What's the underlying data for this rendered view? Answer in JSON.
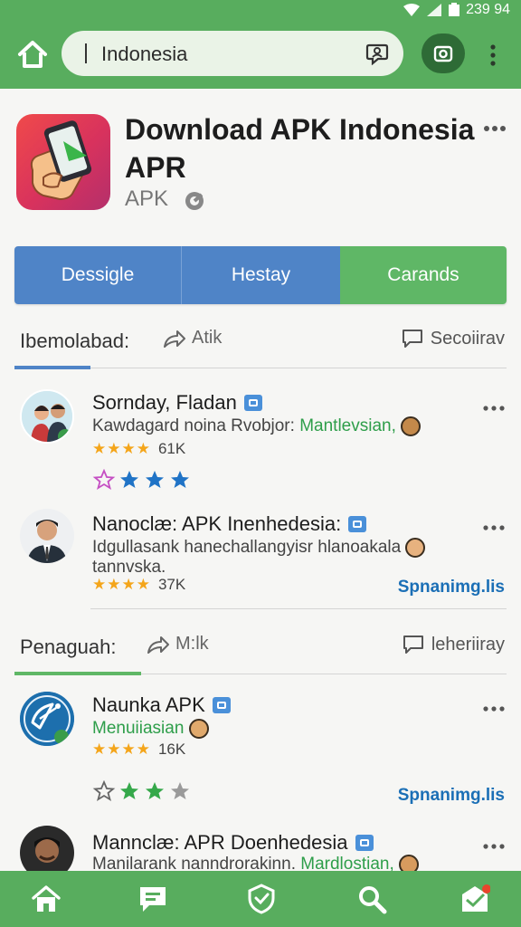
{
  "status_bar": {
    "time": "239 94"
  },
  "browser": {
    "url_text": "Indonesia"
  },
  "app": {
    "title": "Download APK Indonesia APR",
    "subtitle": "APK"
  },
  "tabs": [
    "Dessigle",
    "Hestay",
    "Carands"
  ],
  "sections": [
    {
      "title": "Ibemolabad:",
      "share_label": "Atik",
      "comment_label": "Secoiirav",
      "items": [
        {
          "name": "Sornday, Fladan",
          "desc_plain": "Kawdagard noina Rvobjor: ",
          "desc_highlight": "Mantlevsian,",
          "stars": "★★★★",
          "count": "61K"
        },
        {
          "name": "Nanoclæ: APK Inenhedesia:",
          "desc_plain": "Idgullasank hanechallangyisr hlanoakala",
          "desc_line2": "tannvska.",
          "stars": "★★★★",
          "count": "37K",
          "link": "Spnanimg.lis"
        }
      ]
    },
    {
      "title": "Penaguah:",
      "share_label": "M:lk",
      "comment_label": "leheriiray",
      "items": [
        {
          "name": "Naunka APK",
          "desc_highlight": "Menuiiasian",
          "stars": "★★★★",
          "count": "16K",
          "link": "Spnanimg.lis"
        },
        {
          "name": "Mannclæ: APR Doenhedesia",
          "desc_plain": "Manilarank nanndrorakinn. ",
          "desc_highlight": "Mardlostian,"
        }
      ]
    }
  ],
  "colors": {
    "brand_green": "#58ad5e",
    "tab_blue": "#4f84c7",
    "tab_green": "#5fb766",
    "link_blue": "#1b6fb6",
    "highlight_green": "#2e9e4a",
    "star_gold": "#f4a51a"
  },
  "icons": {
    "bottom_nav": [
      "home-icon",
      "chat-icon",
      "shield-icon",
      "search-icon",
      "inbox-icon"
    ]
  }
}
